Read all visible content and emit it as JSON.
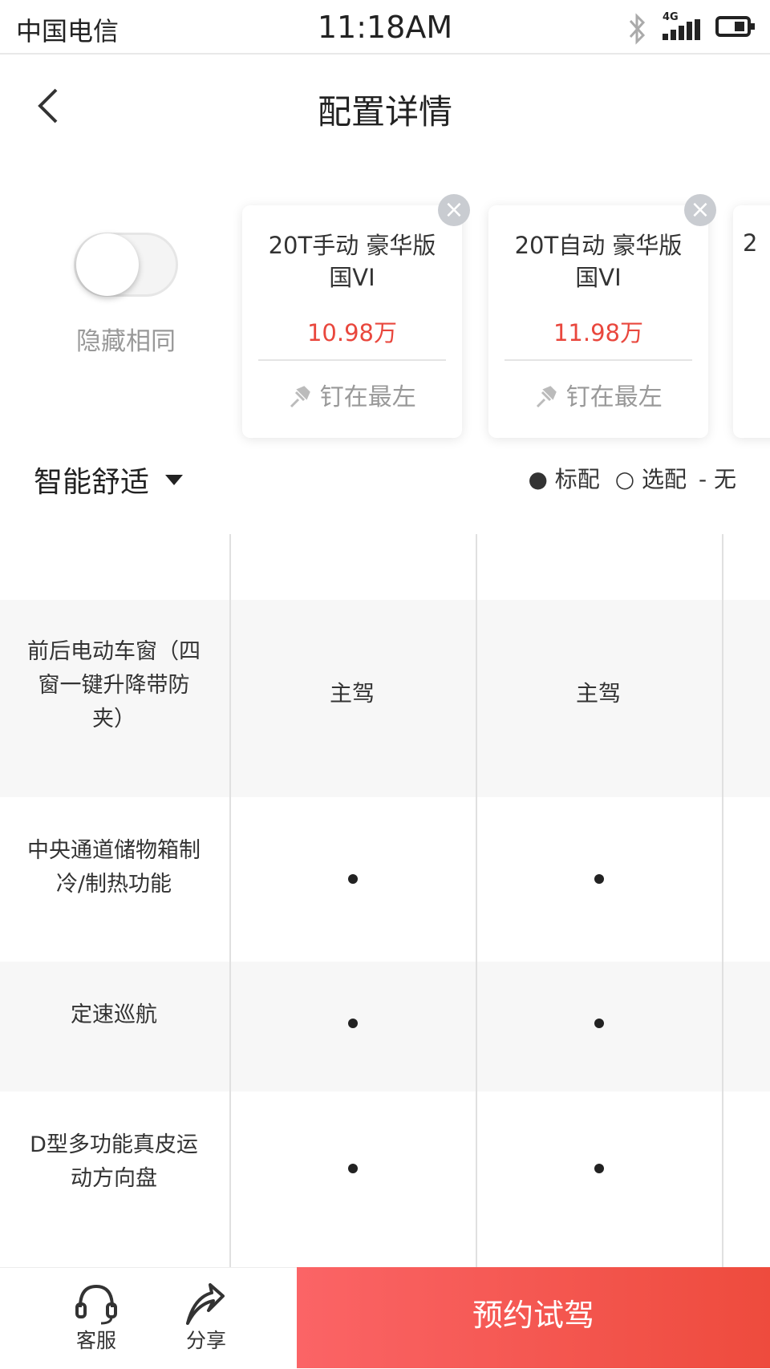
{
  "status_bar": {
    "carrier": "中国电信",
    "time": "11:18AM",
    "network": "4G"
  },
  "header": {
    "title": "配置详情"
  },
  "toggle": {
    "label": "隐藏相同",
    "on": false
  },
  "cards": [
    {
      "name_line1": "20T手动 豪华版",
      "name_line2": "国VI",
      "price": "10.98万",
      "pin_label": "钉在最左"
    },
    {
      "name_line1": "20T自动 豪华版",
      "name_line2": "国VI",
      "price": "11.98万",
      "pin_label": "钉在最左"
    }
  ],
  "partial_card_text": "2",
  "section": {
    "title": "智能舒适"
  },
  "legend": {
    "standard": "标配",
    "optional": "选配",
    "none": "无"
  },
  "rows": [
    {
      "label": [
        "前后电动车窗（四",
        "窗一键升降带防",
        "夹）"
      ],
      "values": [
        "主驾",
        "主驾"
      ]
    },
    {
      "label": [
        "中央通道储物箱制",
        "冷/制热功能"
      ],
      "values": [
        "●",
        "●"
      ]
    },
    {
      "label": [
        "定速巡航"
      ],
      "values": [
        "●",
        "●"
      ]
    },
    {
      "label": [
        "D型多功能真皮运",
        "动方向盘"
      ],
      "values": [
        "●",
        "●"
      ]
    }
  ],
  "bottom": {
    "service": "客服",
    "share": "分享",
    "cta": "预约试驾"
  },
  "colors": {
    "price": "#e9473d",
    "cta_start": "#fb6466",
    "cta_end": "#ee4b3d"
  }
}
